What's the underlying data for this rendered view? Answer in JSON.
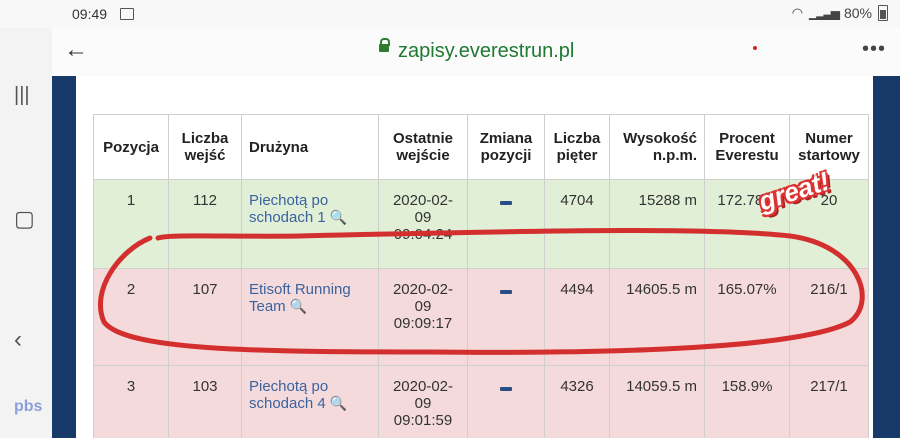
{
  "status_bar": {
    "time": "09:49",
    "battery": "80%"
  },
  "address_bar": {
    "url": "zapisy.everestrun.pl"
  },
  "table": {
    "headers": [
      "Pozycja",
      "Liczba wejść",
      "Drużyna",
      "Ostatnie wejście",
      "Zmiana pozycji",
      "Liczba pięter",
      "Wysokość n.p.m.",
      "Procent Everestu",
      "Numer startowy"
    ],
    "rows": [
      {
        "position": "1",
        "entries": "112",
        "team": "Piechotą po schodach 1",
        "last": "2020-02-09 09:04:24",
        "floors": "4704",
        "height": "15288 m",
        "percent": "172.78%",
        "number": "20"
      },
      {
        "position": "2",
        "entries": "107",
        "team": "Etisoft Running Team",
        "last": "2020-02-09 09:09:17",
        "floors": "4494",
        "height": "14605.5 m",
        "percent": "165.07%",
        "number": "216/1"
      },
      {
        "position": "3",
        "entries": "103",
        "team": "Piechotą po schodach 4",
        "last": "2020-02-09 09:01:59",
        "floors": "4326",
        "height": "14059.5 m",
        "percent": "158.9%",
        "number": "217/1"
      }
    ]
  },
  "sticker": {
    "text": "great!"
  },
  "watermark": "pbs",
  "colors": {
    "accent_green": "#1e7a32",
    "frame_blue": "#173a6a",
    "highlight_red": "#d32f2f"
  }
}
